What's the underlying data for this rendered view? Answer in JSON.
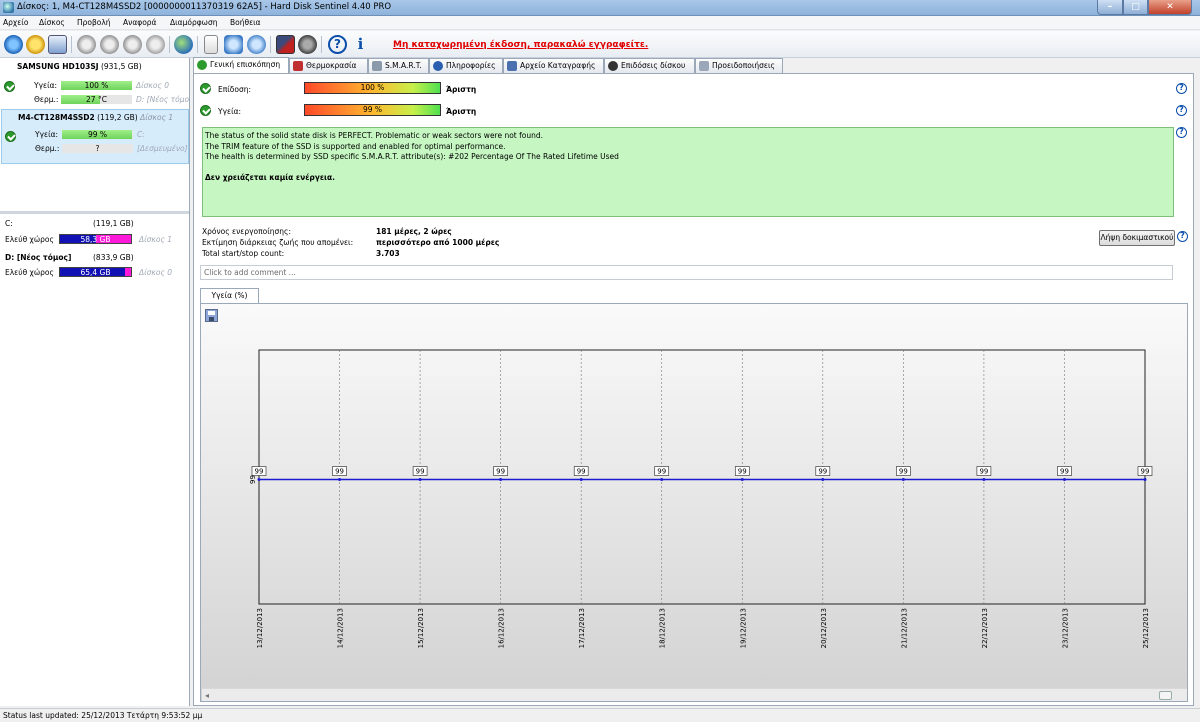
{
  "window": {
    "title": "Δίσκος: 1, M4-CT128M4SSD2 [0000000011370319 62A5]  -  Hard Disk Sentinel 4.40 PRO"
  },
  "menu": [
    "Αρχείο",
    "Δίσκος",
    "Προβολή",
    "Αναφορά",
    "Διαμόρφωση",
    "Βοήθεια"
  ],
  "toolbar": {
    "icons": [
      "refresh-icon",
      "alert-icon",
      "report-icon",
      "disk-tools-icon",
      "disk-test-icon",
      "disk-repair-icon",
      "disk-settings-icon",
      "web-icon",
      "document-icon",
      "options-icon",
      "network-icon",
      "monitor-icon",
      "sound-icon",
      "help-icon",
      "info-icon"
    ],
    "warning": "Μη καταχωρημένη έκδοση, παρακαλώ εγγραφείτε."
  },
  "disks": [
    {
      "name": "SAMSUNG HD103SJ",
      "size": "(931,5 GB)",
      "sub": "",
      "health_label": "Υγεία:",
      "health_value": "100 %",
      "health_fraction": 1.0,
      "health_extra": "Δίσκος 0",
      "temp_label": "Θερμ.:",
      "temp_value": "27 °C",
      "temp_fraction": 0.55,
      "temp_extra": "D: [Νέος τόμος]"
    },
    {
      "name": "M4-CT128M4SSD2",
      "size": "(119,2 GB)",
      "sub": "Δίσκος 1",
      "health_label": "Υγεία:",
      "health_value": "99 %",
      "health_fraction": 0.99,
      "health_extra": "C:",
      "temp_label": "Θερμ.:",
      "temp_value": "?",
      "temp_fraction": 0,
      "temp_extra": "[Δεσμευμένο]"
    }
  ],
  "volumes": [
    {
      "name": "C:",
      "bold": false,
      "size": "(119,1 GB)",
      "free_label": "Ελεύθ χώρος",
      "free_value": "58,3 GB",
      "used_fraction": 0.51,
      "disk": "Δίσκος 1"
    },
    {
      "name": "D: [Νέος τόμος]",
      "bold": true,
      "size": "(833,9 GB)",
      "free_label": "Ελεύθ χώρος",
      "free_value": "65,4 GB",
      "used_fraction": 0.92,
      "disk": "Δίσκος 0"
    }
  ],
  "tabs": [
    {
      "label": "Γενική επισκόπηση",
      "color": "#2d9a2d"
    },
    {
      "label": "Θερμοκρασία",
      "color": "#c03030"
    },
    {
      "label": "S.M.A.R.T.",
      "color": "#6a7a8a"
    },
    {
      "label": "Πληροφορίες",
      "color": "#2a5fb0"
    },
    {
      "label": "Αρχείο Καταγραφής",
      "color": "#4a70b0"
    },
    {
      "label": "Επιδόσεις δίσκου",
      "color": "#333333"
    },
    {
      "label": "Προειδοποιήσεις",
      "color": "#7a8aa0"
    }
  ],
  "overview": {
    "perf_label": "Επίδοση:",
    "perf_value": "100 %",
    "perf_rating": "Άριστη",
    "health_label": "Υγεία:",
    "health_value": "99 %",
    "health_rating": "Άριστη",
    "status_lines": [
      "The status of the solid state disk is PERFECT. Problematic or weak sectors were not found.",
      "The TRIM feature of the SSD is supported and enabled for optimal performance.",
      "The health is determined by SSD specific S.M.A.R.T. attribute(s):  #202 Percentage Of The Rated Lifetime Used"
    ],
    "action": "Δεν χρειάζεται καμία ενέργεια.",
    "power_on_label": "Χρόνος ενεργοποίησης:",
    "power_on_value": "181 μέρες, 2 ώρες",
    "lifetime_label": "Εκτίμηση διάρκειας ζωής που απομένει:",
    "lifetime_value": "περισσότερο από 1000 μέρες",
    "startstop_label": "Total start/stop count:",
    "startstop_value": "3.703",
    "test_button": "Λήψη δοκιμαστικού",
    "comment_placeholder": "Click to add comment ..."
  },
  "chart_tab": "Υγεία (%)",
  "chart_data": {
    "type": "line",
    "x": [
      "13/12/2013",
      "14/12/2013",
      "15/12/2013",
      "16/12/2013",
      "17/12/2013",
      "18/12/2013",
      "19/12/2013",
      "20/12/2013",
      "21/12/2013",
      "22/12/2013",
      "23/12/2013",
      "25/12/2013"
    ],
    "series": [
      {
        "values": [
          99,
          99,
          99,
          99,
          99,
          99,
          99,
          99,
          99,
          99,
          99,
          99
        ],
        "color": "#1a1ad0"
      }
    ],
    "y_tick": "99",
    "grid": true
  },
  "status_bar": "Status last updated: 25/12/2013 Τετάρτη 9:53:52 μμ"
}
